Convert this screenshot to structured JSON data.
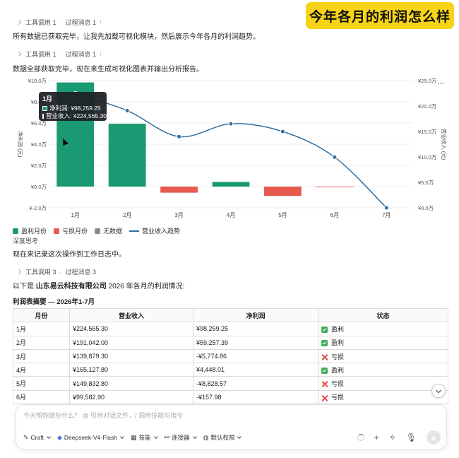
{
  "banner": {
    "title": "今年各月的利润怎么样"
  },
  "steps": [
    {
      "tool": "工具调用 1",
      "process": "过程消息 1"
    },
    {
      "tool": "工具调用 1",
      "process": "过程消息 1"
    },
    {
      "tool": "工具调用 3",
      "process": "过程消息 3"
    }
  ],
  "messages": {
    "m1": "所有数据已获取完毕，让我先加载可视化模块，然后展示今年各月的利润趋势。",
    "m2": "数据全部获取完毕，现在来生成可视化图表并输出分析报告。",
    "deep_think": "深度思考",
    "m3": "现在来记录这次操作到工作日志中。",
    "m4_prefix": "以下是 ",
    "m4_company": "山东易云科技有限公司",
    "m4_suffix": " 2026 年各月的利润情况:"
  },
  "chart_data": {
    "type": "bar",
    "categories": [
      "1月",
      "2月",
      "3月",
      "4月",
      "5月",
      "6月",
      "7月"
    ],
    "series": [
      {
        "name": "净利润",
        "axis": "left",
        "values": [
          98259.25,
          59257.39,
          -5774.86,
          4448.01,
          -8828.57,
          -157.98,
          0
        ]
      },
      {
        "name": "营业收入",
        "axis": "right",
        "type": "line",
        "values": [
          224565.3,
          191042.0,
          139879.3,
          165127.8,
          149832.8,
          99582.9,
          0
        ]
      }
    ],
    "ylabel": "净利润 (元)",
    "y2label": "营业收入 (元)",
    "ylim": [
      -20000,
      100000
    ],
    "y2lim": [
      0,
      250000
    ],
    "yticks": [
      "¥-2.0万",
      "¥0.0万",
      "¥2.0万",
      "¥4.0万",
      "¥6.0万",
      "¥8.0万",
      "¥10.0万"
    ],
    "y2ticks": [
      "¥0.0万",
      "¥5.0万",
      "¥10.0万",
      "¥15.0万",
      "¥20.0万",
      "¥25.0万"
    ],
    "colors": {
      "profit": "#1a9a73",
      "loss": "#e85a4f",
      "none": "#8c8c8c",
      "line": "#2e6fa3"
    },
    "legend": [
      "盈利月份",
      "亏损月份",
      "无数据",
      "营业收入趋势"
    ],
    "legend_position": "bottom-left",
    "grid": true
  },
  "tooltip": {
    "title": "1月",
    "row1": "净利润: ¥98,259.25",
    "row2": "营业收入: ¥224,565.30"
  },
  "table": {
    "title": "利润表摘要 — 2026年1-7月",
    "headers": [
      "月份",
      "营业收入",
      "净利润",
      "状态"
    ],
    "rows": [
      {
        "month": "1月",
        "revenue": "¥224,565.30",
        "profit": "¥98,259.25",
        "status": "盈利",
        "ok": true
      },
      {
        "month": "2月",
        "revenue": "¥191,042.00",
        "profit": "¥59,257.39",
        "status": "盈利",
        "ok": true
      },
      {
        "month": "3月",
        "revenue": "¥139,879.30",
        "profit": "-¥5,774.86",
        "status": "亏损",
        "ok": false
      },
      {
        "month": "4月",
        "revenue": "¥165,127.80",
        "profit": "¥4,448.01",
        "status": "盈利",
        "ok": true
      },
      {
        "month": "5月",
        "revenue": "¥149,832.80",
        "profit": "-¥8,828.57",
        "status": "亏损",
        "ok": false
      },
      {
        "month": "6月",
        "revenue": "¥99,582.90",
        "profit": "-¥157.98",
        "status": "亏损",
        "ok": false
      }
    ]
  },
  "composer": {
    "placeholder": "今天帮你做些什么？ @ 引用对话文件，/ 调用技能与指令",
    "toolbar": [
      "Craft",
      "Deepseek-V4-Flash",
      "技能",
      "连接器",
      "默认权限"
    ]
  }
}
